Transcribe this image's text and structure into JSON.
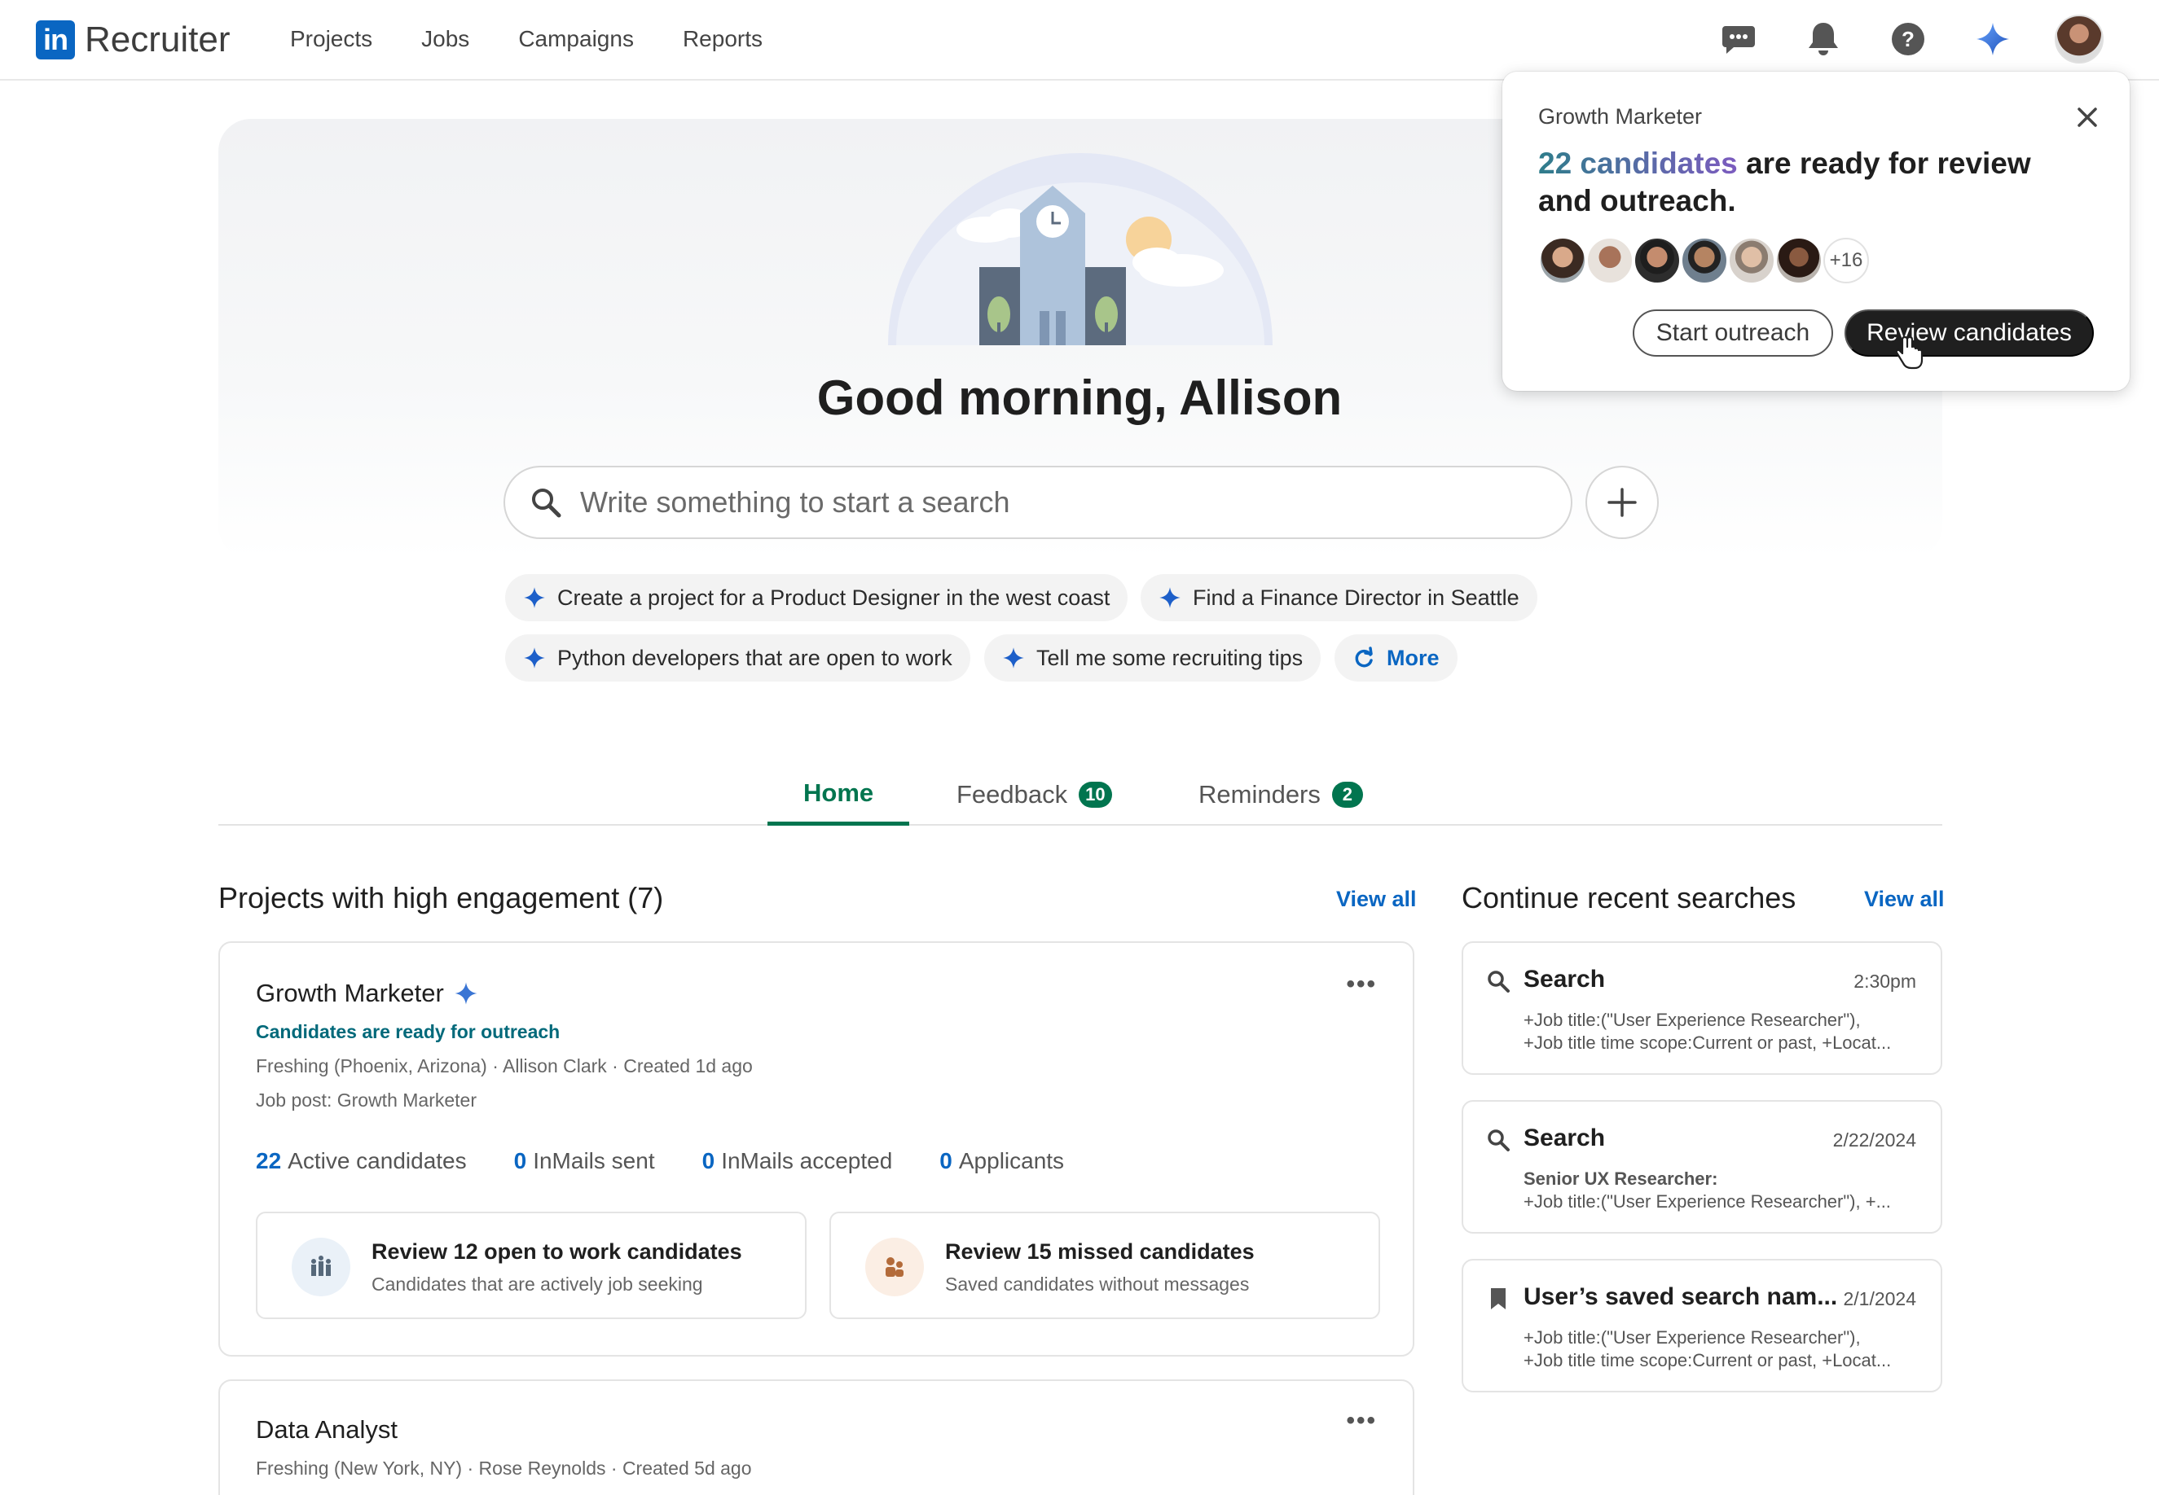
{
  "brand": {
    "logo_mark": "in",
    "app_name": "Recruiter"
  },
  "nav": {
    "links": [
      "Projects",
      "Jobs",
      "Campaigns",
      "Reports"
    ],
    "icons": [
      "messages-icon",
      "notifications-icon",
      "help-icon",
      "ai-sparkle-icon",
      "profile-avatar"
    ]
  },
  "hero": {
    "greeting": "Good morning, Allison",
    "search_placeholder": "Write something to start a search",
    "suggestions": [
      "Create a project for a Product Designer in the west coast",
      "Find a Finance Director in Seattle",
      "Python developers that are open to work",
      "Tell me some recruiting tips"
    ],
    "more_label": "More"
  },
  "tabs": [
    {
      "label": "Home",
      "badge": ""
    },
    {
      "label": "Feedback",
      "badge": "10"
    },
    {
      "label": "Reminders",
      "badge": "2"
    }
  ],
  "projects": {
    "title": "Projects with high engagement (7)",
    "view_all": "View all",
    "items": [
      {
        "name": "Growth Marketer",
        "status": "Candidates are ready for outreach",
        "meta": "Freshing (Phoenix, Arizona) · Allison Clark · Created 1d ago",
        "job_post": "Job post: Growth Marketer",
        "stats": [
          {
            "value": "22",
            "label": "Active candidates"
          },
          {
            "value": "0",
            "label": "InMails sent"
          },
          {
            "value": "0",
            "label": "InMails accepted"
          },
          {
            "value": "0",
            "label": "Applicants"
          }
        ],
        "actions": [
          {
            "title": "Review 12 open to work candidates",
            "subtitle": "Candidates that are actively job seeking"
          },
          {
            "title": "Review 15 missed candidates",
            "subtitle": "Saved candidates without messages"
          }
        ]
      },
      {
        "name": "Data Analyst",
        "meta": "Freshing (New York, NY) · Rose Reynolds · Created 5d ago"
      }
    ]
  },
  "recent_searches": {
    "title": "Continue recent searches",
    "view_all": "View all",
    "items": [
      {
        "title": "Search",
        "date": "2:30pm",
        "line1": "+Job title:(\"User Experience Researcher\"),",
        "line2": "+Job title time scope:Current or past, +Locat..."
      },
      {
        "title": "Search",
        "date": "2/22/2024",
        "line1": "Senior UX Researcher:",
        "line2": "+Job title:(\"User Experience Researcher\"), +..."
      },
      {
        "title": "User’s saved search nam...",
        "date": "2/1/2024",
        "line1": "+Job title:(\"User Experience Researcher\"),",
        "line2": "+Job title time scope:Current or past, +Locat..."
      }
    ]
  },
  "popover": {
    "job": "Growth Marketer",
    "highlight": "22 candidates",
    "headline_rest": " are ready for review and outreach.",
    "more_count": "+16",
    "start_outreach": "Start outreach",
    "review_candidates": "Review candidates"
  },
  "colors": {
    "brand_blue": "#0a66c2",
    "tab_green": "#01754f",
    "status_teal": "#00697a",
    "dark_button": "#1f1f1f"
  }
}
